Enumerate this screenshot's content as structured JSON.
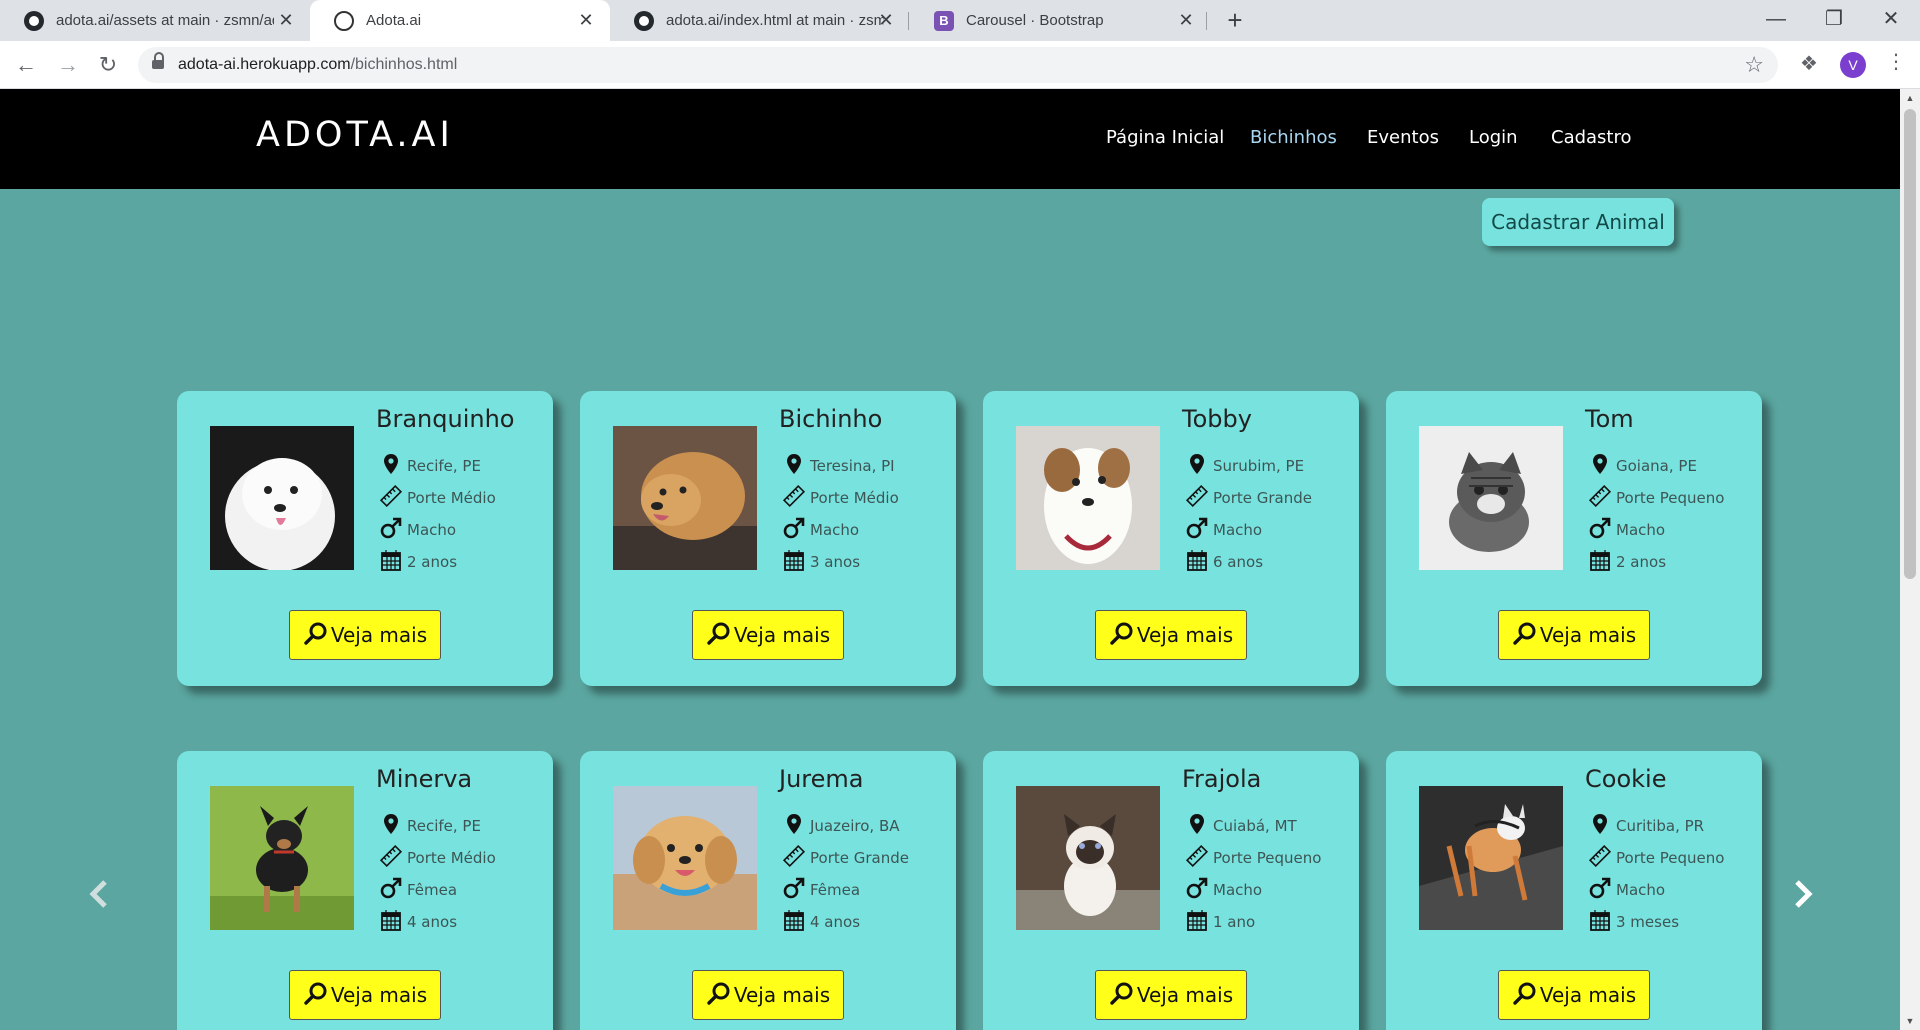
{
  "browser": {
    "tabs": [
      {
        "title": "adota.ai/assets at main · zsmn/adota.ai",
        "icon": "github-icon",
        "active": false
      },
      {
        "title": "Adota.ai",
        "icon": "dog-icon",
        "active": true
      },
      {
        "title": "adota.ai/index.html at main · zsmn/adota.ai",
        "icon": "github-icon",
        "active": false
      },
      {
        "title": "Carousel · Bootstrap",
        "icon": "bootstrap-icon",
        "active": false
      }
    ],
    "close_glyph": "✕",
    "new_tab_glyph": "+",
    "url_host": "adota-ai.herokuapp.com",
    "url_path": "/bichinhos.html",
    "profile_initial": "V"
  },
  "site": {
    "brand": "ADOTA.AI",
    "nav": [
      {
        "label": "Página Inicial",
        "active": false
      },
      {
        "label": "Bichinhos",
        "active": true
      },
      {
        "label": "Eventos",
        "active": false
      },
      {
        "label": "Login",
        "active": false
      },
      {
        "label": "Cadastro",
        "active": false
      }
    ],
    "cadastrar_label": "Cadastrar Animal",
    "veja_label": "Veja mais"
  },
  "animals": [
    {
      "name": "Branquinho",
      "location": "Recife, PE",
      "size": "Porte Médio",
      "sex": "Macho",
      "age": "2 anos",
      "photo": "white-puppy"
    },
    {
      "name": "Bichinho",
      "location": "Teresina, PI",
      "size": "Porte Médio",
      "sex": "Macho",
      "age": "3 anos",
      "photo": "golden-dog"
    },
    {
      "name": "Tobby",
      "location": "Surubim, PE",
      "size": "Porte Grande",
      "sex": "Macho",
      "age": "6 anos",
      "photo": "white-brown-dog"
    },
    {
      "name": "Tom",
      "location": "Goiana, PE",
      "size": "Porte Pequeno",
      "sex": "Macho",
      "age": "2 anos",
      "photo": "tabby-kitten"
    },
    {
      "name": "Minerva",
      "location": "Recife, PE",
      "size": "Porte Médio",
      "sex": "Fêmea",
      "age": "4 anos",
      "photo": "black-puppy"
    },
    {
      "name": "Jurema",
      "location": "Juazeiro, BA",
      "size": "Porte Grande",
      "sex": "Fêmea",
      "age": "4 anos",
      "photo": "golden-puppy"
    },
    {
      "name": "Frajola",
      "location": "Cuiabá, MT",
      "size": "Porte Pequeno",
      "sex": "Macho",
      "age": "1 ano",
      "photo": "siamese-cat"
    },
    {
      "name": "Cookie",
      "location": "Curitiba, PR",
      "size": "Porte Pequeno",
      "sex": "Macho",
      "age": "3 meses",
      "photo": "orange-kitten"
    }
  ],
  "colors": {
    "page_bg": "#5ba6a0",
    "card_bg": "#78e2de",
    "button_bg": "#ffff1a",
    "nav_bg": "#000000",
    "nav_active": "#a9d6f0"
  }
}
